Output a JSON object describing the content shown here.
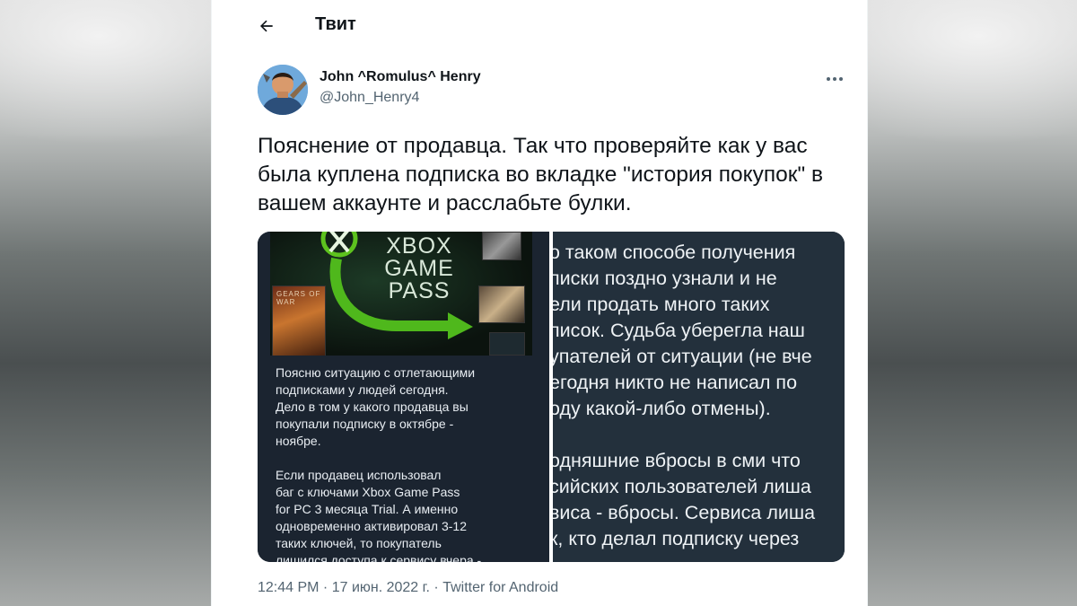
{
  "header": {
    "title": "Твит"
  },
  "tweet": {
    "author_name": "John ^Romulus^ Henry",
    "author_handle": "@John_Henry4",
    "text": "Пояснение от продавца. Так что проверяйте как у вас была куплена подписка во вкладке \"история покупок\" в вашем аккаунте и расслабьте булки.",
    "time": "12:44 PM",
    "date": "17 июн. 2022 г.",
    "separator": " · ",
    "source": "Twitter for Android"
  },
  "media": {
    "banner_text": [
      "XBOX",
      "GAME",
      "PASS"
    ],
    "cover_text": "GEARS OF WAR",
    "left_paragraphs": [
      "Поясню ситуацию с отлетающими\nподписками у людей сегодня.\nДело в том у какого продавца вы\nпокупали подписку в октябре -\nноябре.",
      "Если продавец использовал\nбаг с ключами Xbox Game Pass\nfor PC 3 месяца Trial. А именно\nодновременно активировал 3-12\nтаких ключей, то покупатель\nлишился доступа к сервису вчера -"
    ],
    "right_lines": [
      "о таком способе получения",
      "писки поздно узнали и не",
      "ели продать много таких",
      "писок. Судьба уберегла наш",
      "упателей от ситуации (не вче",
      "егодня никто не написал по",
      "оду какой-либо отмены).",
      "",
      "одняшние вбросы в сми что",
      "сийских пользователей лиша",
      "виса - вбросы. Сервиса лиша",
      "к, кто делал подписку через"
    ]
  },
  "icons": {
    "back": "arrow-left-icon",
    "more": "more-horizontal-icon",
    "xbox": "xbox-logo-icon"
  },
  "colors": {
    "text_primary": "#0f1419",
    "text_secondary": "#536471",
    "xbox_green": "#5dc21e"
  }
}
